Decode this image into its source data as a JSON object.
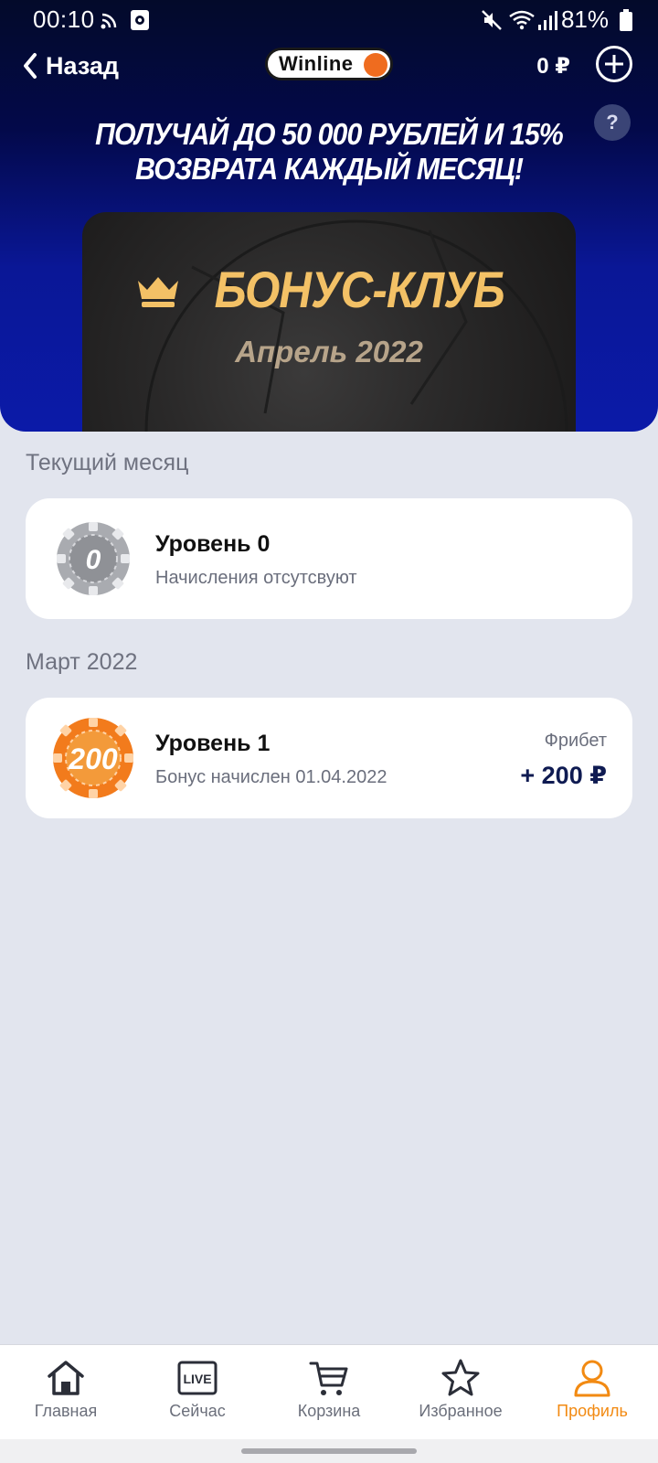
{
  "status_bar": {
    "time": "00:10",
    "battery": "81%"
  },
  "nav": {
    "back_label": "Назад",
    "logo": "Winline",
    "balance": "0 ₽",
    "help": "?"
  },
  "promo": {
    "line1": "ПОЛУЧАЙ ДО 50 000 РУБЛЕЙ И 15%",
    "line2": "ВОЗВРАТА КАЖДЫЙ МЕСЯЦ!"
  },
  "banner": {
    "title": "БОНУС-КЛУБ",
    "subtitle": "Апрель 2022"
  },
  "current": {
    "section": "Текущий месяц",
    "chip_value": "0",
    "level": "Уровень 0",
    "note": "Начисления отсутсвуют"
  },
  "march": {
    "section": "Март 2022",
    "chip_value": "200",
    "level": "Уровень 1",
    "note": "Бонус начислен 01.04.2022",
    "bonus_type": "Фрибет",
    "amount": "+ 200 ₽"
  },
  "bottom_nav": {
    "home": "Главная",
    "live": "Сейчас",
    "live_icon_text": "LIVE",
    "cart": "Корзина",
    "favorites": "Избранное",
    "profile": "Профиль"
  },
  "colors": {
    "accent": "#f28a12",
    "brand_dark": "#03094a",
    "gold": "#f3c166"
  }
}
